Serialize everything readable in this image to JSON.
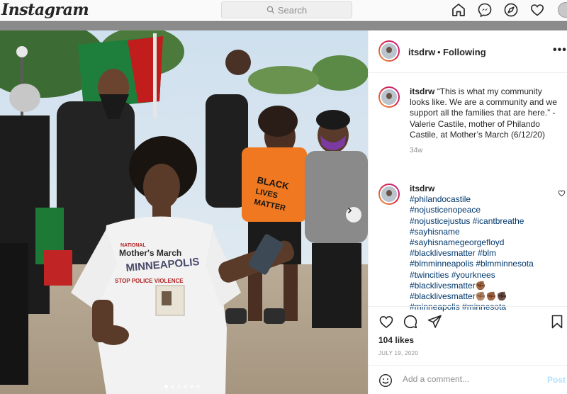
{
  "nav": {
    "logo": "Instagram",
    "search_placeholder": "Search",
    "icons": [
      "home-icon",
      "messenger-icon",
      "explore-icon",
      "activity-heart-icon",
      "profile-avatar"
    ]
  },
  "post": {
    "username": "itsdrw",
    "separator": "•",
    "follow_status": "Following",
    "more": "•••",
    "carousel": {
      "slides": 6,
      "active_index": 0
    },
    "caption": {
      "username": "itsdrw",
      "text": "“This is what my community looks like. We are a community and we support all the families that are here.” - Valerie Castile, mother of Philando Castile, at Mother’s March (6/12/20)",
      "time": "34w"
    },
    "hashtag_comment": {
      "username": "itsdrw",
      "lines": [
        "#philandocastile",
        "#nojusticenopeace",
        "#nojusticejustus #icantbreathe",
        "#sayhisname",
        "#sayhisnamegeorgefloyd",
        "#blacklivesmatter #blm",
        "#blmminneapolis #blmminnesota",
        "#twincities #yourknees",
        "#blacklivesmatter✊🏾",
        "#blacklivesmatter✊🏽✊🏾✊🏿",
        "#minneapolis #minnesota"
      ]
    },
    "likes": "104 likes",
    "date": "JULY 19, 2020",
    "comment_placeholder": "Add a comment...",
    "post_button": "Post"
  },
  "photo_text": {
    "shirt_line1": "NATIONAL",
    "shirt_line2": "Mother's March",
    "shirt_line3": "MINNEAPOLIS",
    "shirt_line4": "STOP POLICE VIOLENCE",
    "sign_line1": "BLACK",
    "sign_line2": "LIVES",
    "sign_line3": "MATTER"
  },
  "colors": {
    "link": "#00376b",
    "post_disabled": "#b2dffc",
    "orange_shirt": "#f07820"
  }
}
